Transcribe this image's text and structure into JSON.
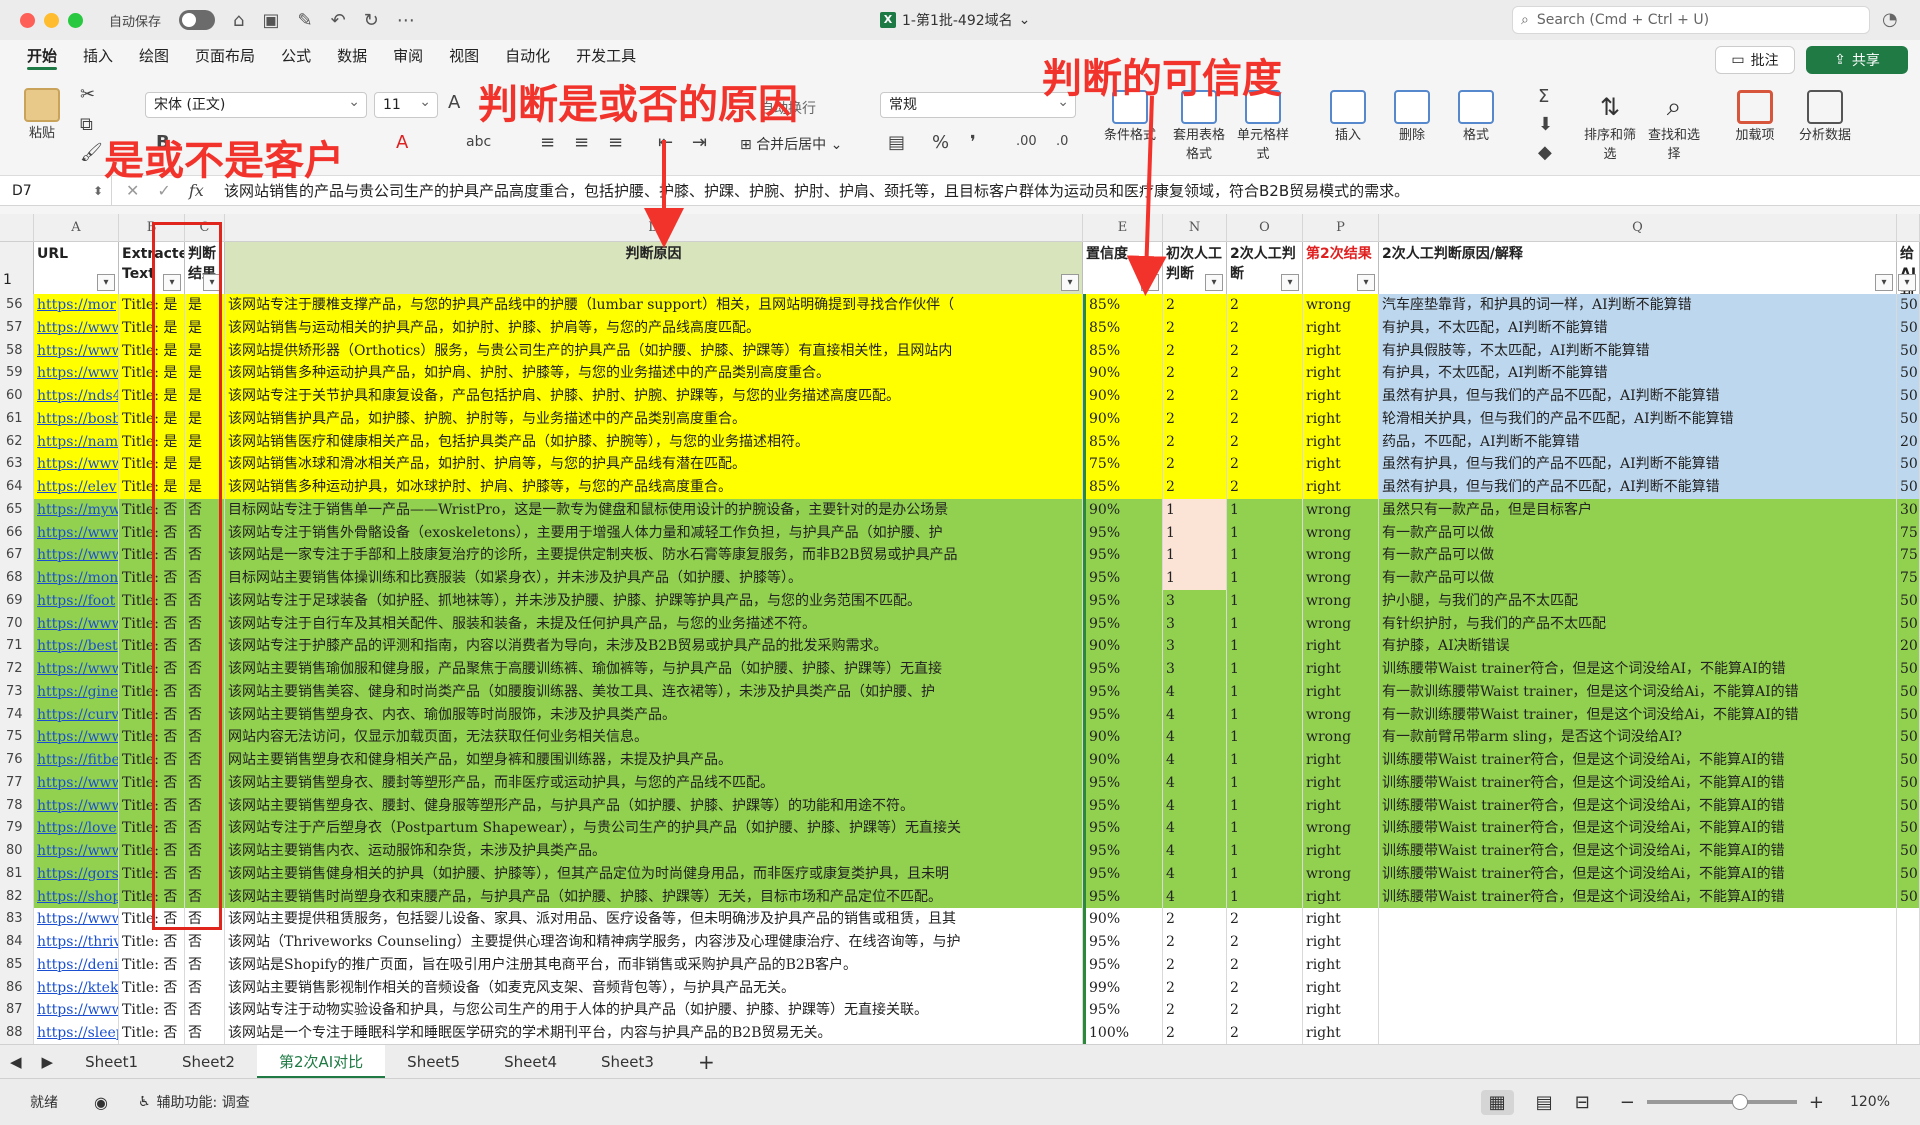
{
  "titlebar": {
    "autosave": "自动保存",
    "doc_title": "1-第1批-492域名",
    "search_placeholder": "Search (Cmd + Ctrl + U)"
  },
  "tabs": [
    "开始",
    "插入",
    "绘图",
    "页面布局",
    "公式",
    "数据",
    "审阅",
    "视图",
    "自动化",
    "开发工具"
  ],
  "buttons": {
    "comment": "批注",
    "share": "共享"
  },
  "ribbon": {
    "paste": "粘贴",
    "font": "宋体 (正文)",
    "size": "11",
    "number_format": "常规",
    "merge": "合并后居中",
    "wrap": "自动换行",
    "cond_format": "条件格式",
    "table_format": "套用表格格式",
    "cell_style": "单元格样式",
    "insert": "插入",
    "delete": "删除",
    "format": "格式",
    "sort_filter": "排序和筛选",
    "find_select": "查找和选择",
    "addins": "加载项",
    "analyze": "分析数据"
  },
  "formula": {
    "cell": "D7",
    "text": "该网站销售的产品与贵公司生产的护具产品高度重合，包括护腰、护膝、护踝、护腕、护肘、护肩、颈托等，且目标客户群体为运动员和医疗康复领域，符合B2B贸易模式的需求。"
  },
  "columns": [
    "A",
    "B",
    "C",
    "D",
    "E",
    "N",
    "O",
    "P",
    "Q",
    ""
  ],
  "header_row": {
    "num": "1",
    "url": "URL",
    "extracted": "Extracted Text",
    "judge": "判断结果",
    "reason": "判断原因",
    "conf": "置信度",
    "first": "初次人工判断",
    "second": "2次人工判断",
    "second_result": "第2次结果",
    "second_reason": "2次人工判断原因/解释",
    "last": "给AI判断打"
  },
  "rows": [
    [
      "56",
      "https://mor",
      "Title: 是",
      "是",
      "该网站专注于腰椎支撑产品，与您的护具产品线中的护腰（lumbar support）相关，且网站明确提到寻找合作伙伴（",
      "85%",
      "2",
      "2",
      "wrong",
      "汽车座垫靠背，和护具的词一样，AI判断不能算错",
      "50"
    ],
    [
      "57",
      "https://www",
      "Title: 是",
      "是",
      "该网站销售与运动相关的护具产品，如护肘、护膝、护肩等，与您的产品线高度匹配。",
      "85%",
      "2",
      "2",
      "right",
      "有护具，不太匹配，AI判断不能算错",
      "50"
    ],
    [
      "58",
      "https://www",
      "Title: 是",
      "是",
      "该网站提供矫形器（Orthotics）服务，与贵公司生产的护具产品（如护腰、护膝、护踝等）有直接相关性，且网站内",
      "85%",
      "2",
      "2",
      "right",
      "有护具假肢等，不太匹配，AI判断不能算错",
      "50"
    ],
    [
      "59",
      "https://www",
      "Title: 是",
      "是",
      "该网站销售多种运动护具产品，如护肩、护肘、护膝等，与您的业务描述中的产品类别高度重合。",
      "90%",
      "2",
      "2",
      "right",
      "有护具，不太匹配，AI判断不能算错",
      "50"
    ],
    [
      "60",
      "https://nds4",
      "Title: 是",
      "是",
      "该网站专注于关节护具和康复设备，产品包括护肩、护膝、护肘、护腕、护踝等，与您的业务描述高度匹配。",
      "90%",
      "2",
      "2",
      "right",
      "虽然有护具，但与我们的产品不匹配，AI判断不能算错",
      "50"
    ],
    [
      "61",
      "https://bosb",
      "Title: 是",
      "是",
      "该网站销售护具产品，如护膝、护腕、护肘等，与业务描述中的产品类别高度重合。",
      "90%",
      "2",
      "2",
      "right",
      "轮滑相关护具，但与我们的产品不匹配，AI判断不能算错",
      "50"
    ],
    [
      "62",
      "https://nam",
      "Title: 是",
      "是",
      "该网站销售医疗和健康相关产品，包括护具类产品（如护膝、护腕等），与您的业务描述相符。",
      "85%",
      "2",
      "2",
      "right",
      "药品，不匹配，AI判断不能算错",
      "20"
    ],
    [
      "63",
      "https://www",
      "Title: 是",
      "是",
      "该网站销售冰球和滑冰相关产品，如护肘、护肩等，与您的护具产品线有潜在匹配。",
      "75%",
      "2",
      "2",
      "right",
      "虽然有护具，但与我们的产品不匹配，AI判断不能算错",
      "50"
    ],
    [
      "64",
      "https://elev",
      "Title: 是",
      "是",
      "该网站销售多种运动护具，如冰球护肘、护肩、护膝等，与您的产品线高度重合。",
      "85%",
      "2",
      "2",
      "right",
      "虽然有护具，但与我们的产品不匹配，AI判断不能算错",
      "50"
    ],
    [
      "65",
      "https://myw",
      "Title: 否",
      "否",
      "目标网站专注于销售单一产品——WristPro，这是一款专为健盘和鼠标使用设计的护腕设备，主要针对的是办公场景",
      "90%",
      "1",
      "1",
      "wrong",
      "虽然只有一款产品，但是目标客户",
      "30"
    ],
    [
      "66",
      "https://www",
      "Title: 否",
      "否",
      "该网站专注于销售外骨骼设备（exoskeletons），主要用于增强人体力量和减轻工作负担，与护具产品（如护腰、护",
      "95%",
      "1",
      "1",
      "wrong",
      "有一款产品可以做",
      "75"
    ],
    [
      "67",
      "https://www",
      "Title: 否",
      "否",
      "该网站是一家专注于手部和上肢康复治疗的诊所，主要提供定制夹板、防水石膏等康复服务，而非B2B贸易或护具产品",
      "95%",
      "1",
      "1",
      "wrong",
      "有一款产品可以做",
      "75"
    ],
    [
      "68",
      "https://mon",
      "Title: 否",
      "否",
      "目标网站主要销售体操训练和比赛服装（如紧身衣），并未涉及护具产品（如护腰、护膝等）。",
      "95%",
      "1",
      "1",
      "wrong",
      "有一款产品可以做",
      "75"
    ],
    [
      "69",
      "https://foot",
      "Title: 否",
      "否",
      "该网站专注于足球装备（如护胫、抓地袜等），并未涉及护腰、护膝、护踝等护具产品，与您的业务范围不匹配。",
      "95%",
      "3",
      "1",
      "wrong",
      "护小腿，与我们的产品不太匹配",
      "50"
    ],
    [
      "70",
      "https://www",
      "Title: 否",
      "否",
      "该网站专注于自行车及其相关配件、服装和装备，未提及任何护具产品，与您的业务描述不符。",
      "95%",
      "3",
      "1",
      "wrong",
      "有针织护肘，与我们的产品不太匹配",
      "50"
    ],
    [
      "71",
      "https://best",
      "Title: 否",
      "否",
      "该网站专注于护膝产品的评测和指南，内容以消费者为导向，未涉及B2B贸易或护具产品的批发采购需求。",
      "90%",
      "3",
      "1",
      "right",
      "有护膝，AI决断错误",
      "20"
    ],
    [
      "72",
      "https://www",
      "Title: 否",
      "否",
      "该网站主要销售瑜伽服和健身服，产品聚焦于高腰训练裤、瑜伽裤等，与护具产品（如护腰、护膝、护踝等）无直接",
      "95%",
      "3",
      "1",
      "right",
      "训练腰带Waist trainer符合，但是这个词没给AI，不能算AI的错",
      "50"
    ],
    [
      "73",
      "https://gine",
      "Title: 否",
      "否",
      "该网站主要销售美容、健身和时尚类产品（如腰腹训练器、美妆工具、连衣裙等），未涉及护具类产品（如护腰、护",
      "95%",
      "4",
      "1",
      "right",
      "有一款训练腰带Waist trainer，但是这个词没给Ai，不能算AI的错",
      "50"
    ],
    [
      "74",
      "https://curv",
      "Title: 否",
      "否",
      "该网站主要销售塑身衣、内衣、瑜伽服等时尚服饰，未涉及护具类产品。",
      "95%",
      "4",
      "1",
      "wrong",
      "有一款训练腰带Waist trainer，但是这个词没给Ai，不能算AI的错",
      "50"
    ],
    [
      "75",
      "https://www",
      "Title: 否",
      "否",
      "网站内容无法访问，仅显示加载页面，无法获取任何业务相关信息。",
      "90%",
      "4",
      "1",
      "wrong",
      "有一款前臂吊带arm sling，是否这个词没给AI?",
      "50"
    ],
    [
      "76",
      "https://fitbe",
      "Title: 否",
      "否",
      "网站主要销售塑身衣和健身相关产品，如塑身裤和腰围训练器，未提及护具产品。",
      "90%",
      "4",
      "1",
      "right",
      "训练腰带Waist trainer符合，但是这个词没给Ai，不能算AI的错",
      "50"
    ],
    [
      "77",
      "https://www",
      "Title: 否",
      "否",
      "该网站主要销售塑身衣、腰封等塑形产品，而非医疗或运动护具，与您的产品线不匹配。",
      "95%",
      "4",
      "1",
      "right",
      "训练腰带Waist trainer符合，但是这个词没给Ai，不能算AI的错",
      "50"
    ],
    [
      "78",
      "https://www",
      "Title: 否",
      "否",
      "该网站主要销售塑身衣、腰封、健身服等塑形产品，与护具产品（如护腰、护膝、护踝等）的功能和用途不符。",
      "95%",
      "4",
      "1",
      "right",
      "训练腰带Waist trainer符合，但是这个词没给Ai，不能算AI的错",
      "50"
    ],
    [
      "79",
      "https://love",
      "Title: 否",
      "否",
      "该网站专注于产后塑身衣（Postpartum Shapewear），与贵公司生产的护具产品（如护腰、护膝、护踝等）无直接关",
      "95%",
      "4",
      "1",
      "wrong",
      "训练腰带Waist trainer符合，但是这个词没给Ai，不能算AI的错",
      "50"
    ],
    [
      "80",
      "https://www",
      "Title: 否",
      "否",
      "该网站主要销售内衣、运动服饰和杂货，未涉及护具类产品。",
      "95%",
      "4",
      "1",
      "right",
      "训练腰带Waist trainer符合，但是这个词没给Ai，不能算AI的错",
      "50"
    ],
    [
      "81",
      "https://gors",
      "Title: 否",
      "否",
      "该网站主要销售健身相关的护具（如护腰、护膝等），但其产品定位为时尚健身用品，而非医疗或康复类护具，且未明",
      "95%",
      "4",
      "1",
      "wrong",
      "训练腰带Waist trainer符合，但是这个词没给Ai，不能算AI的错",
      "50"
    ],
    [
      "82",
      "https://shop",
      "Title: 否",
      "否",
      "该网站主要销售时尚塑身衣和束腰产品，与护具产品（如护腰、护膝、护踝等）无关，目标市场和产品定位不匹配。",
      "95%",
      "4",
      "1",
      "right",
      "训练腰带Waist trainer符合，但是这个词没给Ai，不能算AI的错",
      "50"
    ],
    [
      "83",
      "https://www",
      "Title: 否",
      "否",
      "该网站主要提供租赁服务，包括婴儿设备、家具、派对用品、医疗设备等，但未明确涉及护具产品的销售或租赁，且其",
      "90%",
      "2",
      "2",
      "right",
      "",
      ""
    ],
    [
      "84",
      "https://thriv",
      "Title: 否",
      "否",
      "该网站（Thriveworks Counseling）主要提供心理咨询和精神病学服务，内容涉及心理健康治疗、在线咨询等，与护",
      "95%",
      "2",
      "2",
      "right",
      "",
      ""
    ],
    [
      "85",
      "https://deni",
      "Title: 否",
      "否",
      "该网站是Shopify的推广页面，旨在吸引用户注册其电商平台，而非销售或采购护具产品的B2B客户。",
      "95%",
      "2",
      "2",
      "right",
      "",
      ""
    ],
    [
      "86",
      "https://ktek",
      "Title: 否",
      "否",
      "该网站主要销售影视制作相关的音频设备（如麦克风支架、音频背包等），与护具产品无关。",
      "99%",
      "2",
      "2",
      "right",
      "",
      ""
    ],
    [
      "87",
      "https://www",
      "Title: 否",
      "否",
      "该网站专注于动物实验设备和护具，与您公司生产的用于人体的护具产品（如护腰、护膝、护踝等）无直接关联。",
      "95%",
      "2",
      "2",
      "right",
      "",
      ""
    ],
    [
      "88",
      "https://sleep",
      "Title: 否",
      "否",
      "该网站是一个专注于睡眠科学和睡眠医学研究的学术期刊平台，内容与护具产品的B2B贸易无关。",
      "100%",
      "2",
      "2",
      "right",
      "",
      ""
    ]
  ],
  "sheets": [
    "Sheet1",
    "Sheet2",
    "第2次AI对比",
    "Sheet5",
    "Sheet4",
    "Sheet3"
  ],
  "status": {
    "ready": "就绪",
    "accessibility": "辅助功能: 调查",
    "zoom": "120%"
  },
  "annotations": {
    "customer": "是或不是客户",
    "reason": "判断是或否的原因",
    "confidence": "判断的可信度"
  },
  "colors": {
    "yellow": "#ffff00",
    "green": "#92d050",
    "blue": "#bdd7ee",
    "peach": "#fbe3d6",
    "red": "#f2332c",
    "brand": "#1f7a44"
  }
}
